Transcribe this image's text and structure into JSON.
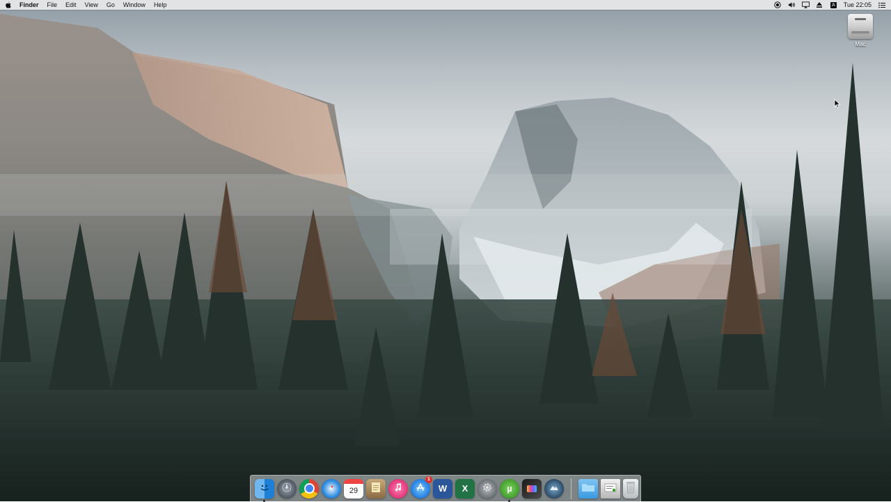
{
  "menubar": {
    "apple_icon": "apple-logo-icon",
    "app_name": "Finder",
    "menus": [
      "File",
      "Edit",
      "View",
      "Go",
      "Window",
      "Help"
    ],
    "status_icons": [
      "screen-record-icon",
      "volume-icon",
      "airplay-icon",
      "eject-icon",
      "input-source-icon"
    ],
    "input_source_label": "A",
    "clock": "Tue 22:05",
    "notification_icon": "notification-list-icon"
  },
  "desktop": {
    "drive_icon": "hard-drive-icon",
    "drive_label": "Mac"
  },
  "dock": {
    "apps": [
      {
        "name": "finder",
        "icon": "finder-icon",
        "running": true
      },
      {
        "name": "launchpad",
        "icon": "launchpad-icon",
        "running": false
      },
      {
        "name": "chrome",
        "icon": "chrome-icon",
        "running": false
      },
      {
        "name": "safari",
        "icon": "safari-icon",
        "running": false
      },
      {
        "name": "calendar",
        "icon": "calendar-icon",
        "day": "29",
        "running": false
      },
      {
        "name": "notes",
        "icon": "notes-icon",
        "running": false
      },
      {
        "name": "itunes",
        "icon": "itunes-icon",
        "running": false
      },
      {
        "name": "app-store",
        "icon": "app-store-icon",
        "badge": "1",
        "running": false
      },
      {
        "name": "word",
        "icon": "word-icon",
        "glyph": "W",
        "running": false
      },
      {
        "name": "excel",
        "icon": "excel-icon",
        "glyph": "X",
        "running": false
      },
      {
        "name": "system-preferences",
        "icon": "gear-icon",
        "running": false
      },
      {
        "name": "utorrent",
        "icon": "utorrent-icon",
        "glyph": "µ",
        "running": true
      },
      {
        "name": "final-cut-pro",
        "icon": "final-cut-icon",
        "running": false
      },
      {
        "name": "macos-installer",
        "icon": "installer-icon",
        "running": false
      }
    ],
    "stacks": [
      {
        "name": "downloads",
        "icon": "folder-icon"
      },
      {
        "name": "documents",
        "icon": "documents-stack-icon"
      },
      {
        "name": "trash",
        "icon": "trash-icon"
      }
    ]
  }
}
